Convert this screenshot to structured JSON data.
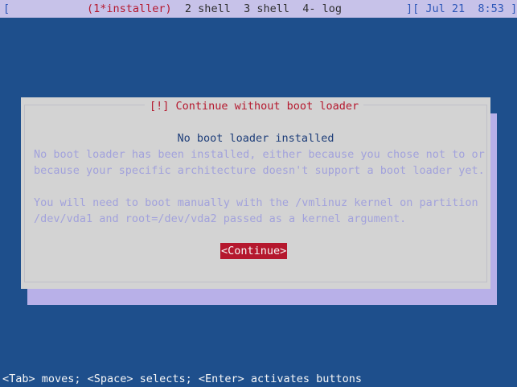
{
  "topbar": {
    "left_bracket": "[",
    "windows": [
      {
        "label": "(1*installer)",
        "active": true
      },
      {
        "label": "  2 shell",
        "active": false
      },
      {
        "label": "  3 shell",
        "active": false
      },
      {
        "label": "  4- log",
        "active": false
      }
    ],
    "right_brackets": "][",
    "date": " Jul 21",
    "time": "  8:53 ]"
  },
  "dialog": {
    "title": "[!] Continue without boot loader",
    "heading": "No boot loader installed",
    "para1_line1": "No boot loader has been installed, either because you chose not to or",
    "para1_line2": "because your specific architecture doesn't support a boot loader yet.",
    "para2_line1": "You will need to boot manually with the /vmlinuz kernel on partition",
    "para2_line2": "/dev/vda1 and root=/dev/vda2 passed as a kernel argument.",
    "continue_button": "<Continue>"
  },
  "help": {
    "text": "<Tab> moves; <Space> selects; <Enter> activates buttons"
  },
  "colors": {
    "background": "#1e4f8c",
    "dialog_bg": "#d3d3d3",
    "title_red": "#b5182e",
    "text_disabled": "#a2a2dc",
    "heading_blue": "#1d3d79",
    "topbar_bg": "#c7c2e9"
  }
}
